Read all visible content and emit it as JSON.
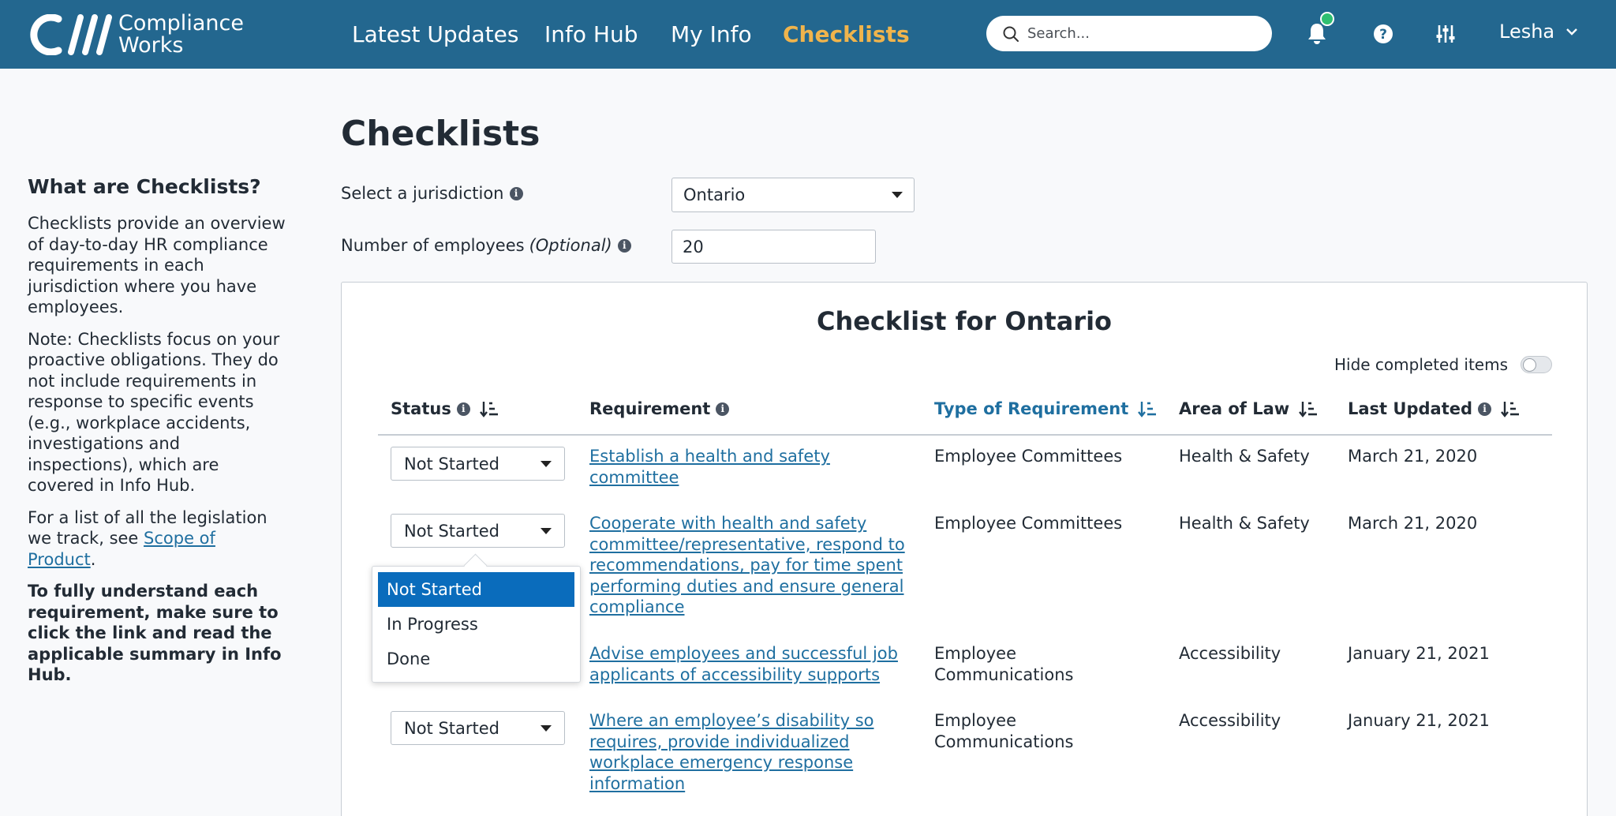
{
  "brand": {
    "line1": "Compliance",
    "line2": "Works"
  },
  "nav": [
    {
      "label": "Latest Updates"
    },
    {
      "label": "Info Hub"
    },
    {
      "label": "My Info"
    },
    {
      "label": "Checklists"
    }
  ],
  "search": {
    "placeholder": "Search..."
  },
  "user": {
    "name": "Lesha"
  },
  "sidebar": {
    "heading": "What are Checklists?",
    "para1": "Checklists provide an overview of day-to-day HR compliance requirements in each jurisdiction where you have employees.",
    "para2": "Note: Checklists focus on your proactive obligations. They do not include requirements in response to specific events (e.g., workplace accidents, investigations and inspections), which are covered in Info Hub.",
    "para3_prefix": "For a list of all the legislation we track, see ",
    "para3_link": "Scope of Product",
    "para3_suffix": ".",
    "para4": "To fully understand each requirement, make sure to click the link and read the applicable summary in Info Hub."
  },
  "page": {
    "title": "Checklists",
    "jurisdiction_label": "Select a jurisdiction",
    "jurisdiction_value": "Ontario",
    "employees_label": "Number of employees",
    "employees_optional": "(Optional)",
    "employees_value": "20"
  },
  "checklist": {
    "title": "Checklist for Ontario",
    "hide_label": "Hide completed items",
    "columns": {
      "status": "Status",
      "requirement": "Requirement",
      "type": "Type of Requirement",
      "area": "Area of Law",
      "updated": "Last Updated"
    },
    "rows": [
      {
        "status": "Not Started",
        "requirement": "Establish a health and safety committee",
        "type": "Employee Committees",
        "area": "Health & Safety",
        "updated": "March 21, 2020"
      },
      {
        "status": "Not Started",
        "requirement": "Cooperate with health and safety committee/representative, respond to recommendations, pay for time spent performing duties and ensure general compliance",
        "type": "Employee Committees",
        "area": "Health & Safety",
        "updated": "March 21, 2020"
      },
      {
        "status": "",
        "requirement": "Advise employees and successful job applicants of accessibility supports",
        "type": "Employee Communications",
        "area": "Accessibility",
        "updated": "January 21, 2021"
      },
      {
        "status": "Not Started",
        "requirement": "Where an employee’s disability so requires, provide individualized workplace emergency response information",
        "type": "Employee Communications",
        "area": "Accessibility",
        "updated": "January 21, 2021"
      }
    ],
    "status_options": [
      "Not Started",
      "In Progress",
      "Done"
    ]
  },
  "colors": {
    "header": "#23678f",
    "active_nav": "#f0b44c",
    "link": "#1f6fa0",
    "selected_option": "#0a6cbc"
  }
}
